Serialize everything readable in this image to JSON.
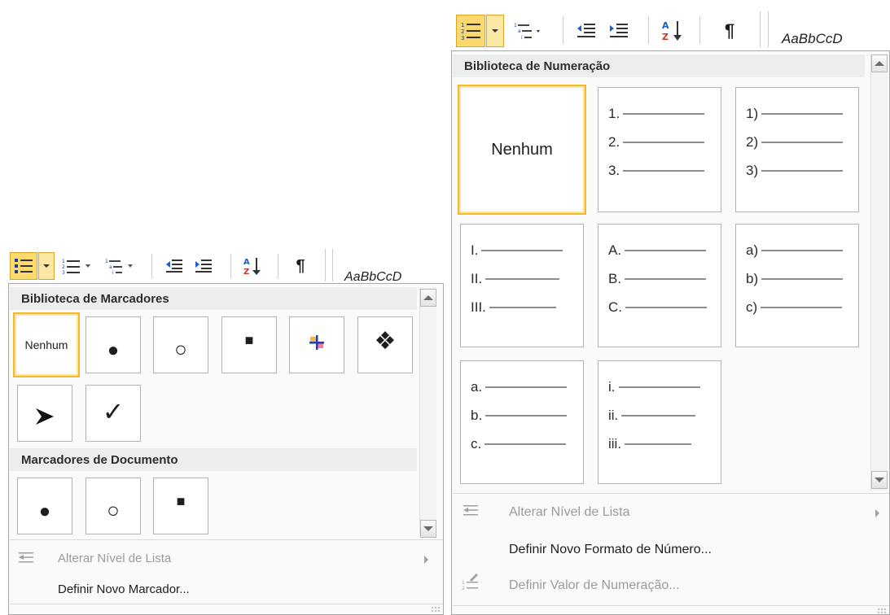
{
  "bullets_panel": {
    "ribbon": {
      "bullets_icon": "bullet-list-icon",
      "numbering_icon": "numbered-list-icon",
      "multilevel_icon": "multilevel-list-icon",
      "decrease_indent_icon": "decrease-indent-icon",
      "increase_indent_icon": "increase-indent-icon",
      "sort_icon": "sort-az-icon",
      "pilcrow": "¶",
      "style_preview": "AaBbCcD"
    },
    "section_library": "Biblioteca de Marcadores",
    "library_cells": [
      "Nenhum",
      "●",
      "○",
      "■",
      "colored-cross-bullet",
      "❖",
      "➢",
      "✓"
    ],
    "section_document": "Marcadores de Documento",
    "document_cells": [
      "●",
      "○",
      "■"
    ],
    "menu": {
      "change_level": "Alterar Nível de Lista",
      "define_new": "Definir Novo Marcador..."
    }
  },
  "numbering_panel": {
    "ribbon": {
      "numbering_icon": "numbered-list-icon",
      "multilevel_icon": "multilevel-list-icon",
      "decrease_indent_icon": "decrease-indent-icon",
      "increase_indent_icon": "increase-indent-icon",
      "sort_icon": "sort-az-icon",
      "pilcrow": "¶",
      "style_preview": "AaBbCcD"
    },
    "section_library": "Biblioteca de Numeração",
    "none_label": "Nenhum",
    "formats": [
      [
        "1.",
        "2.",
        "3."
      ],
      [
        "1)",
        "2)",
        "3)"
      ],
      [
        "I.",
        "II.",
        "III."
      ],
      [
        "A.",
        "B.",
        "C."
      ],
      [
        "a)",
        "b)",
        "c)"
      ],
      [
        "a.",
        "b.",
        "c."
      ],
      [
        "i.",
        "ii.",
        "iii."
      ]
    ],
    "menu": {
      "change_level": "Alterar Nível de Lista",
      "define_new_format": "Definir Novo Formato de Número...",
      "set_value": "Definir Valor de Numeração..."
    }
  }
}
